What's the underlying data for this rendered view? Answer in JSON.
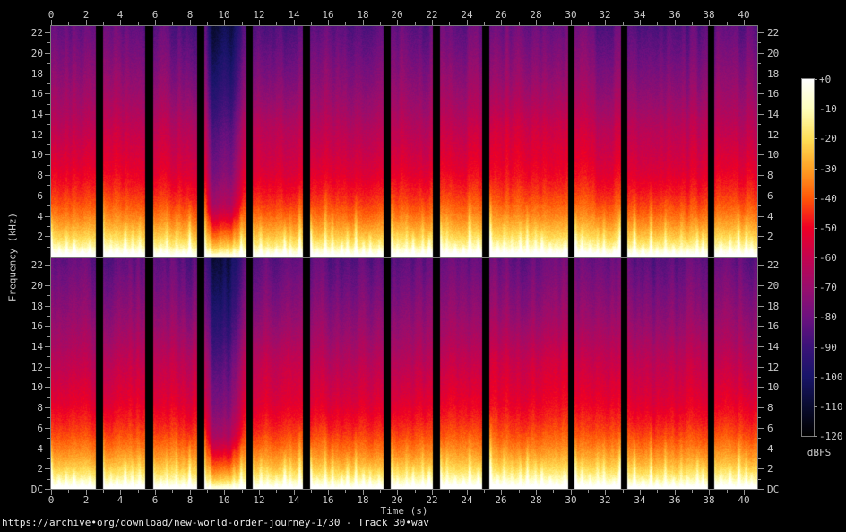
{
  "footer": {
    "source_text": "https://archive•org/download/new-world-order-journey-1/30 - Track 30•wav"
  },
  "axes": {
    "time": {
      "label": "Time (s)",
      "major_ticks": [
        0,
        2,
        4,
        6,
        8,
        10,
        12,
        14,
        16,
        18,
        20,
        22,
        24,
        26,
        28,
        30,
        32,
        34,
        36,
        38,
        40
      ],
      "minor_ticks": [
        1,
        3,
        5,
        7,
        9,
        11,
        13,
        15,
        17,
        19,
        21,
        23,
        25,
        27,
        29,
        31,
        33,
        35,
        37,
        39
      ],
      "range_s": [
        0,
        40.78
      ]
    },
    "freq": {
      "label": "Frequency (kHz)",
      "major_ticks_khz": [
        22,
        20,
        18,
        16,
        14,
        12,
        10,
        8,
        6,
        4,
        2
      ],
      "minor_ticks_khz": [
        21,
        19,
        17,
        15,
        13,
        11,
        9,
        7,
        5,
        3,
        1
      ],
      "dc_label": "DC",
      "range_khz": [
        0,
        22.05
      ]
    }
  },
  "colorbar": {
    "label": "dBFS",
    "ticks": [
      "+0",
      "-10",
      "-20",
      "-30",
      "-40",
      "-50",
      "-60",
      "-70",
      "-80",
      "-90",
      "-100",
      "-110",
      "-120"
    ],
    "range_db": [
      0,
      -120
    ],
    "palette_stops": [
      [
        -120,
        "#000000"
      ],
      [
        -110,
        "#0a0c30"
      ],
      [
        -100,
        "#19156a"
      ],
      [
        -90,
        "#3b1379"
      ],
      [
        -80,
        "#6e1180"
      ],
      [
        -70,
        "#9a0e6d"
      ],
      [
        -60,
        "#c40450"
      ],
      [
        -50,
        "#ef0025"
      ],
      [
        -40,
        "#ff5808"
      ],
      [
        -30,
        "#ffa226"
      ],
      [
        -20,
        "#ffe058"
      ],
      [
        -10,
        "#ffffbd"
      ],
      [
        0,
        "#ffffff"
      ]
    ]
  },
  "chart_data": {
    "type": "heatmap",
    "subtype": "stereo-audio-spectrogram",
    "channels": [
      "channel-1-top",
      "channel-2-bottom"
    ],
    "duration_s": 40.78,
    "nyquist_khz": 22.05,
    "db_range": [
      -120,
      0
    ],
    "silence_gaps_s": [
      [
        2.54,
        2.95
      ],
      [
        5.43,
        5.85
      ],
      [
        8.43,
        8.8
      ],
      [
        11.28,
        11.64
      ],
      [
        14.54,
        14.95
      ],
      [
        19.15,
        19.61
      ],
      [
        22.04,
        22.41
      ],
      [
        24.89,
        25.3
      ],
      [
        29.81,
        30.22
      ],
      [
        32.91,
        33.27
      ],
      [
        37.93,
        38.29
      ]
    ],
    "quiet_passage_s": [
      8.9,
      9.3,
      10.35,
      11.1
    ],
    "beat_period_s": 0.44,
    "mean_spectrum_dbfs": [
      [
        0,
        -3
      ],
      [
        0.4,
        -8
      ],
      [
        1,
        -14
      ],
      [
        2,
        -23
      ],
      [
        3,
        -30
      ],
      [
        4,
        -36
      ],
      [
        5,
        -41
      ],
      [
        6,
        -45
      ],
      [
        8,
        -52
      ],
      [
        10,
        -57
      ],
      [
        12,
        -62
      ],
      [
        14,
        -67
      ],
      [
        16,
        -71
      ],
      [
        18,
        -75
      ],
      [
        20,
        -79
      ],
      [
        22.05,
        -83
      ]
    ]
  }
}
